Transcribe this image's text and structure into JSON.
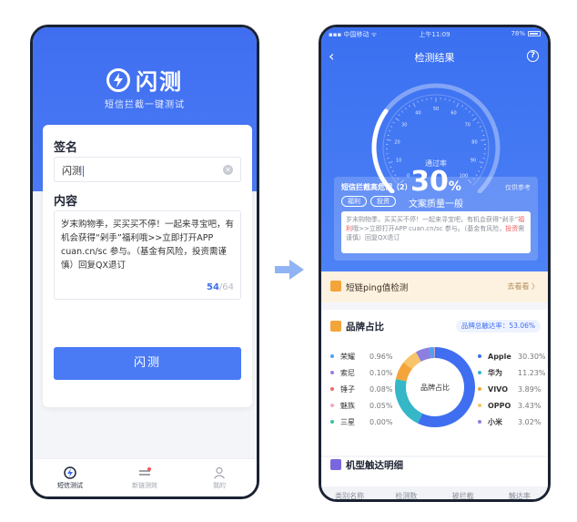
{
  "left": {
    "app_name": "闪测",
    "subtitle": "短信拦截一键测试",
    "signature_label": "签名",
    "signature_value": "闪测",
    "content_label": "内容",
    "content_text": "岁末购物季，买买买不停！一起来寻宝吧，有机会获得“剁手”福利哦>>立即打开APP cuan.cn/sc 参与。（基金有风险，投资需谨慎）回复QX退订",
    "count_current": "54",
    "count_max": "/64",
    "submit_label": "闪测",
    "tabs": [
      {
        "label": "短信测试",
        "active": true
      },
      {
        "label": "新链测效",
        "active": false
      },
      {
        "label": "我的",
        "active": false
      }
    ]
  },
  "right": {
    "status": {
      "carrier": "中国移动",
      "time": "上午11:09",
      "battery": "78%"
    },
    "nav_title": "检测结果",
    "gauge": {
      "pass_label": "通过率",
      "pass_value": "30",
      "pass_unit": "%",
      "quality": "文案质量一般",
      "ticks": [
        "0",
        "10",
        "20",
        "30",
        "40",
        "50",
        "60",
        "70",
        "80",
        "90",
        "100"
      ],
      "pass_fraction": 0.3
    },
    "warning": {
      "title": "短信拦截高危词（2）",
      "note": "仅供参考",
      "tags": [
        "福利",
        "投资"
      ],
      "msg_parts": [
        {
          "t": "岁末购物季，买买买不停！一起来寻宝吧，有机会获得“剁手”",
          "hl": false
        },
        {
          "t": "福利",
          "hl": true
        },
        {
          "t": "哦>>立即打开APP cuan.cn/sc 参与。（基金有风险，",
          "hl": false
        },
        {
          "t": "投资",
          "hl": true
        },
        {
          "t": "需谨慎）回复QX退订",
          "hl": false
        }
      ]
    },
    "ping": {
      "label": "短链ping值检测",
      "link": "去看看 〉"
    },
    "brand": {
      "title": "品牌占比",
      "total_rate": "品牌总触达率：53.06%",
      "donut_label": "品牌占比",
      "left_items": [
        {
          "name": "荣耀",
          "value": "0.96%",
          "color": "#4aa3f0"
        },
        {
          "name": "索尼",
          "value": "0.10%",
          "color": "#9b7be8"
        },
        {
          "name": "锤子",
          "value": "0.08%",
          "color": "#f06a6a"
        },
        {
          "name": "魅族",
          "value": "0.05%",
          "color": "#f4a8c0"
        },
        {
          "name": "三星",
          "value": "0.00%",
          "color": "#3cc39a"
        }
      ],
      "right_items": [
        {
          "name": "Apple",
          "value": "30.30%",
          "color": "#3f6ef0"
        },
        {
          "name": "华为",
          "value": "11.23%",
          "color": "#35b7c8"
        },
        {
          "name": "VIVO",
          "value": "3.89%",
          "color": "#f4a53a"
        },
        {
          "name": "OPPO",
          "value": "3.43%",
          "color": "#f7c46a"
        },
        {
          "name": "小米",
          "value": "3.02%",
          "color": "#8d7fe0"
        }
      ]
    },
    "model": {
      "title": "机型触达明细",
      "columns": [
        "类别名称",
        "检测数",
        "被拦截",
        "触达率"
      ]
    }
  }
}
